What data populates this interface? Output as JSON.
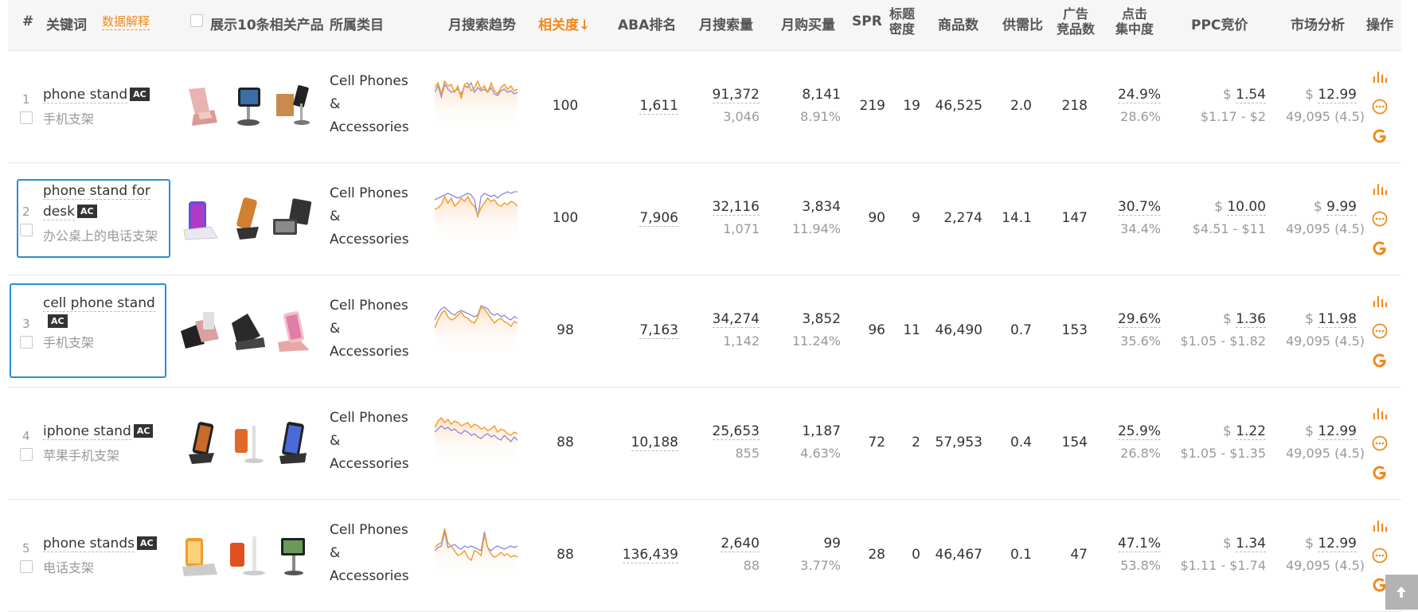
{
  "header": {
    "num": "#",
    "keyword": "关键词",
    "explain": "数据解释",
    "show10": "展示10条相关产品",
    "category": "所属类目",
    "trend": "月搜索趋势",
    "relevance": "相关度↓",
    "aba": "ABA排名",
    "search_vol": "月搜索量",
    "purchase_vol": "月购买量",
    "spr": "SPR",
    "title_density_1": "标题",
    "title_density_2": "密度",
    "products": "商品数",
    "supply_demand": "供需比",
    "ad_products_1": "广告",
    "ad_products_2": "竞品数",
    "click_conc_1": "点击",
    "click_conc_2": "集中度",
    "ppc": "PPC竞价",
    "market": "市场分析",
    "ops": "操作"
  },
  "colors": {
    "accent": "#f08a1c",
    "highlight": "#2a8cd8",
    "trend_orange": "#f0a030",
    "trend_purple": "#8a8ae0"
  },
  "rows": [
    {
      "num": "1",
      "kw": "phone stand",
      "kw2": "",
      "ac": "AC",
      "cn": "手机支架",
      "cat1": "Cell Phones",
      "cat2": "&",
      "cat3": "Accessories",
      "relevance": "100",
      "aba": "1,611",
      "search": "91,372",
      "search_sub": "3,046",
      "purchase": "8,141",
      "purchase_sub": "8.91%",
      "spr": "219",
      "density": "19",
      "products": "46,525",
      "ratio": "2.0",
      "ads": "218",
      "click": "24.9%",
      "click_sub": "28.6%",
      "ppc_cur": "$",
      "ppc": "1.54",
      "ppc_range": "$1.17 - $2",
      "mkt_cur": "$",
      "mkt": "12.99",
      "mkt_sub": "49,095 (4.5)"
    },
    {
      "num": "2",
      "kw": "phone stand for",
      "kw2": "desk",
      "ac": "AC",
      "cn": "办公桌上的电话支架",
      "cat1": "Cell Phones",
      "cat2": "&",
      "cat3": "Accessories",
      "relevance": "100",
      "aba": "7,906",
      "search": "32,116",
      "search_sub": "1,071",
      "purchase": "3,834",
      "purchase_sub": "11.94%",
      "spr": "90",
      "density": "9",
      "products": "2,274",
      "ratio": "14.1",
      "ads": "147",
      "click": "30.7%",
      "click_sub": "34.4%",
      "ppc_cur": "$",
      "ppc": "10.00",
      "ppc_range": "$4.51 - $11",
      "mkt_cur": "$",
      "mkt": "9.99",
      "mkt_sub": "49,095 (4.5)"
    },
    {
      "num": "3",
      "kw": "cell phone stand",
      "kw2": "",
      "ac": "AC",
      "cn": "手机支架",
      "cat1": "Cell Phones",
      "cat2": "&",
      "cat3": "Accessories",
      "relevance": "98",
      "aba": "7,163",
      "search": "34,274",
      "search_sub": "1,142",
      "purchase": "3,852",
      "purchase_sub": "11.24%",
      "spr": "96",
      "density": "11",
      "products": "46,490",
      "ratio": "0.7",
      "ads": "153",
      "click": "29.6%",
      "click_sub": "35.6%",
      "ppc_cur": "$",
      "ppc": "1.36",
      "ppc_range": "$1.05 - $1.82",
      "mkt_cur": "$",
      "mkt": "11.98",
      "mkt_sub": "49,095 (4.5)"
    },
    {
      "num": "4",
      "kw": "iphone stand",
      "kw2": "",
      "ac": "AC",
      "cn": "苹果手机支架",
      "cat1": "Cell Phones",
      "cat2": "&",
      "cat3": "Accessories",
      "relevance": "88",
      "aba": "10,188",
      "search": "25,653",
      "search_sub": "855",
      "purchase": "1,187",
      "purchase_sub": "4.63%",
      "spr": "72",
      "density": "2",
      "products": "57,953",
      "ratio": "0.4",
      "ads": "154",
      "click": "25.9%",
      "click_sub": "26.8%",
      "ppc_cur": "$",
      "ppc": "1.22",
      "ppc_range": "$1.05 - $1.35",
      "mkt_cur": "$",
      "mkt": "12.99",
      "mkt_sub": "49,095 (4.5)"
    },
    {
      "num": "5",
      "kw": "phone stands",
      "kw2": "",
      "ac": "AC",
      "cn": "电话支架",
      "cat1": "Cell Phones",
      "cat2": "&",
      "cat3": "Accessories",
      "relevance": "88",
      "aba": "136,439",
      "search": "2,640",
      "search_sub": "88",
      "purchase": "99",
      "purchase_sub": "3.77%",
      "spr": "28",
      "density": "0",
      "products": "46,467",
      "ratio": "0.1",
      "ads": "47",
      "click": "47.1%",
      "click_sub": "53.8%",
      "ppc_cur": "$",
      "ppc": "1.34",
      "ppc_range": "$1.11 - $1.74",
      "mkt_cur": "$",
      "mkt": "12.99",
      "mkt_sub": "49,095 (4.5)"
    }
  ]
}
